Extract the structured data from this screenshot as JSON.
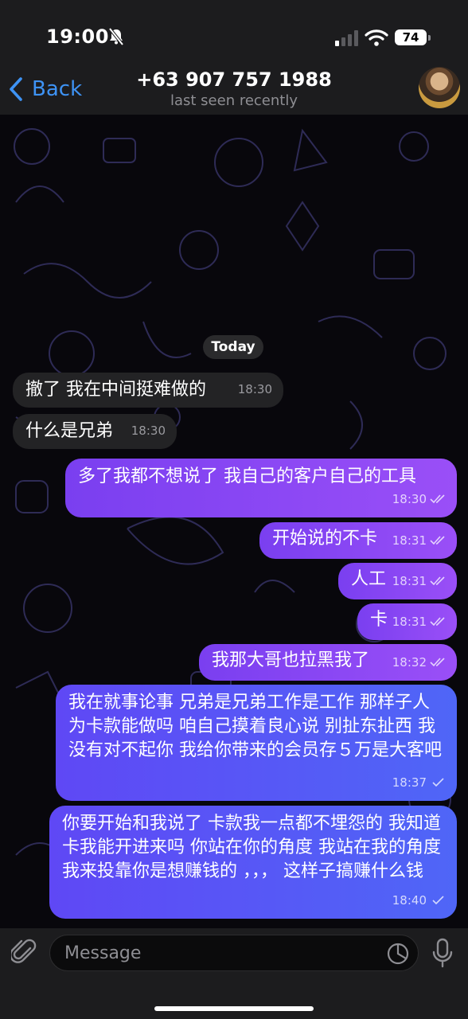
{
  "status_bar": {
    "time": "19:00",
    "battery": "74"
  },
  "header": {
    "back_label": "Back",
    "contact": "+63 907 757 1988",
    "presence": "last seen recently"
  },
  "date_separator": "Today",
  "messages": [
    {
      "dir": "in",
      "text": "撤了  我在中间挺难做的",
      "time": "18:30"
    },
    {
      "dir": "in",
      "text": "什么是兄弟",
      "time": "18:30"
    },
    {
      "dir": "out",
      "text": "多了我都不想说了   我自己的客户自己的工具",
      "time": "18:30"
    },
    {
      "dir": "out",
      "text": "开始说的不卡",
      "time": "18:31"
    },
    {
      "dir": "out",
      "text": "人工",
      "time": "18:31"
    },
    {
      "dir": "out",
      "text": "卡",
      "time": "18:31"
    },
    {
      "dir": "out",
      "text": "我那大哥也拉黑我了",
      "time": "18:32"
    },
    {
      "dir": "out",
      "text": "我在就事论事  兄弟是兄弟工作是工作  那样子人为卡款能做吗  咱自己摸着良心说   别扯东扯西 我没有对不起你  我给你带来的会员存５万是大客吧",
      "time": "18:37"
    },
    {
      "dir": "out",
      "text": "你要开始和我说了 卡款我一点都不埋怨的 我知道卡我能开进来吗   你站在你的角度  我站在我的角度 我来投靠你是想赚钱的  ，，，  这样子搞赚什么钱",
      "time": "18:40"
    }
  ],
  "composer": {
    "placeholder": "Message"
  },
  "colors": {
    "accent": "#3e93f5",
    "outgoing": "#8a45f5",
    "incoming": "#232325"
  }
}
